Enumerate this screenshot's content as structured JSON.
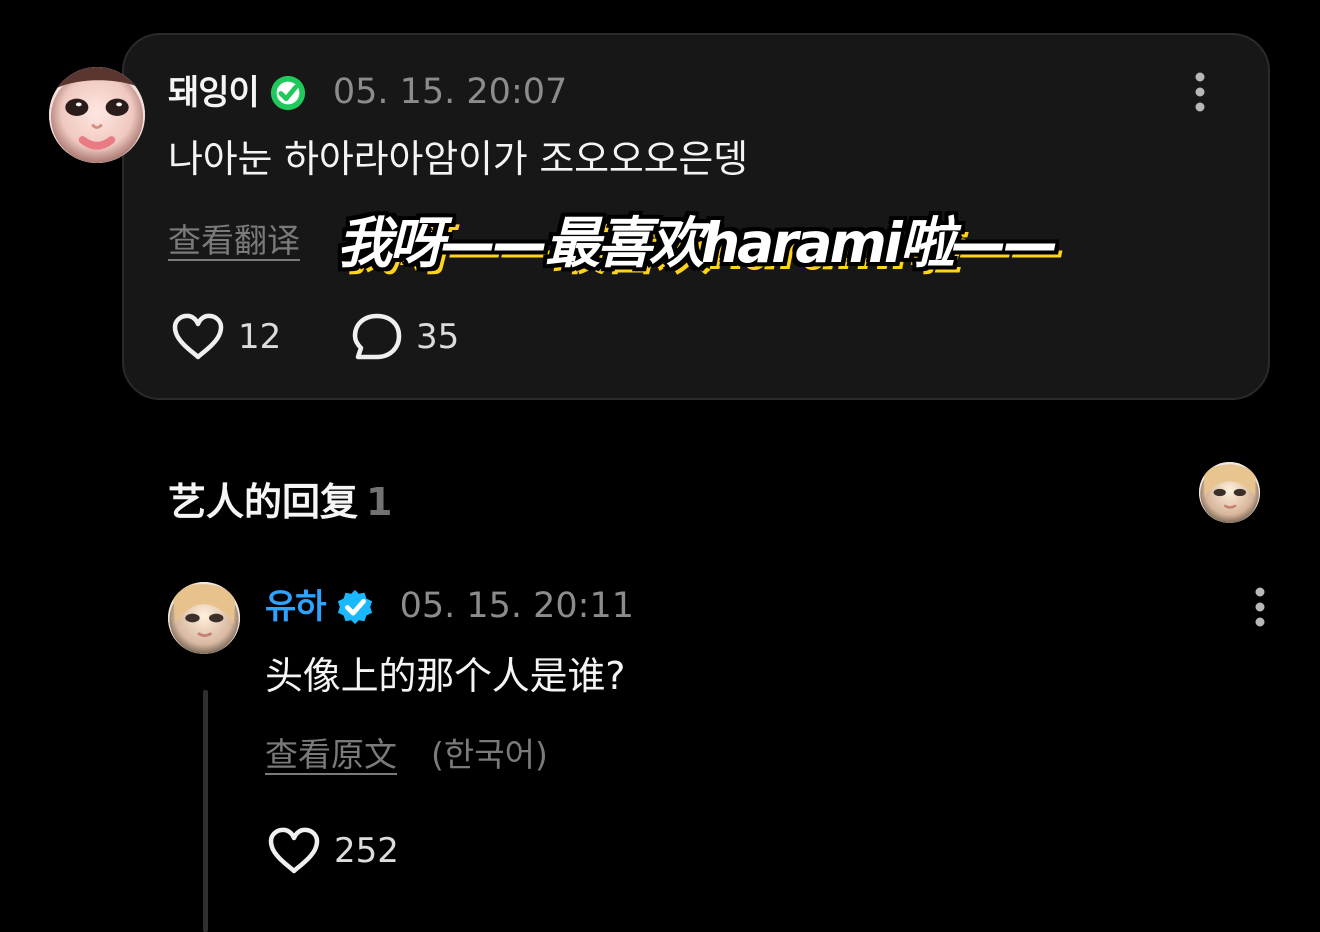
{
  "main_comment": {
    "username": "돼잉이",
    "timestamp": "05. 15. 20:07",
    "text": "나아눈 하아라아암이가 조오오오은뎅",
    "translate_link": "查看翻译",
    "overlay_caption": "我呀——最喜欢harami啦——",
    "likes": "12",
    "comments": "35",
    "verified_color": "#20c95b"
  },
  "artist_replies": {
    "title": "艺人的回复",
    "count": "1"
  },
  "reply": {
    "username": "유하",
    "timestamp": "05. 15. 20:11",
    "text": "头像上的那个人是谁?",
    "original_link": "查看原文",
    "language_note": "(한국어)",
    "likes": "252",
    "verified_color": "#19b8ff"
  },
  "icons": {
    "main_avatar": "avatar-image",
    "header_avatar": "avatar-image",
    "reply_avatar": "avatar-image",
    "more": "more-vertical-icon",
    "like": "heart-outline-icon",
    "comment": "comment-bubble-icon",
    "verified": "verified-check-icon"
  },
  "colors": {
    "background": "#000000",
    "card_background": "#171717",
    "reply_username": "#2ea4ff",
    "muted_text": "#8c8c8c",
    "caption_highlight": "#ffd21c"
  }
}
